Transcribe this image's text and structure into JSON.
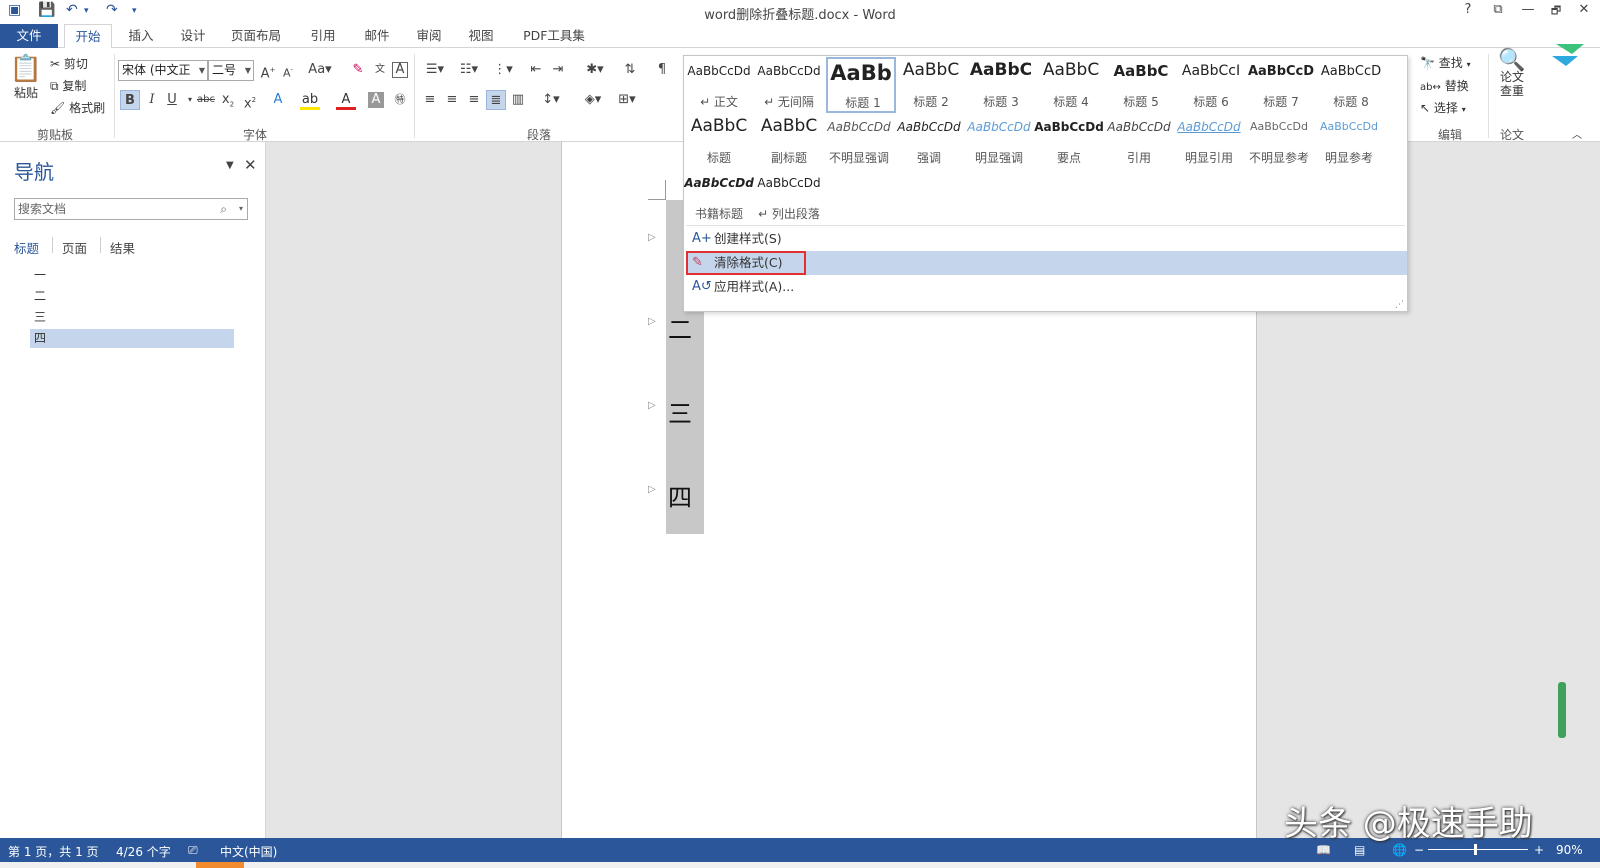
{
  "window": {
    "title": "word删除折叠标题.docx - Word",
    "help": "?",
    "restore_ribbon": "⧉",
    "minimize": "—",
    "maximize": "🗗",
    "close": "✕"
  },
  "tabs": [
    "文件",
    "开始",
    "插入",
    "设计",
    "页面布局",
    "引用",
    "邮件",
    "审阅",
    "视图",
    "PDF工具集"
  ],
  "ribbon": {
    "clipboard": {
      "paste": "粘贴",
      "cut": "剪切",
      "copy": "复制",
      "format_painter": "格式刷",
      "label": "剪贴板"
    },
    "font": {
      "font_name": "宋体 (中文正",
      "font_size": "二号",
      "label": "字体"
    },
    "paragraph": {
      "label": "段落"
    },
    "editing": {
      "find": "查找",
      "replace": "替换",
      "select": "选择",
      "label": "编辑"
    },
    "thesis": {
      "check_line1": "论文",
      "check_line2": "查重",
      "label": "论文"
    }
  },
  "navigation": {
    "title": "导航",
    "search_placeholder": "搜索文档",
    "tabs": [
      "标题",
      "页面",
      "结果"
    ],
    "headings": [
      "一",
      "二",
      "三",
      "四"
    ],
    "selected_heading_index": 3
  },
  "document": {
    "headings": [
      "二",
      "三",
      "四"
    ]
  },
  "style_gallery": {
    "styles": [
      {
        "sample": "AaBbCcDd",
        "name": "↵ 正文"
      },
      {
        "sample": "AaBbCcDd",
        "name": "↵ 无间隔"
      },
      {
        "sample": "AaBb",
        "name": "标题 1"
      },
      {
        "sample": "AaBbC",
        "name": "标题 2"
      },
      {
        "sample": "AaBbC",
        "name": "标题 3"
      },
      {
        "sample": "AaBbC",
        "name": "标题 4"
      },
      {
        "sample": "AaBbC",
        "name": "标题 5"
      },
      {
        "sample": "AaBbCcI",
        "name": "标题 6"
      },
      {
        "sample": "AaBbCcD",
        "name": "标题 7"
      },
      {
        "sample": "AaBbCcD",
        "name": "标题 8"
      },
      {
        "sample": "AaBbC",
        "name": "标题"
      },
      {
        "sample": "AaBbC",
        "name": "副标题"
      },
      {
        "sample": "AaBbCcDd",
        "name": "不明显强调"
      },
      {
        "sample": "AaBbCcDd",
        "name": "强调"
      },
      {
        "sample": "AaBbCcDd",
        "name": "明显强调"
      },
      {
        "sample": "AaBbCcDd",
        "name": "要点"
      },
      {
        "sample": "AaBbCcDd",
        "name": "引用"
      },
      {
        "sample": "AaBbCcDd",
        "name": "明显引用"
      },
      {
        "sample": "AaBbCcDd",
        "name": "不明显参考"
      },
      {
        "sample": "AaBbCcDd",
        "name": "明显参考"
      },
      {
        "sample": "AaBbCcDd",
        "name": "书籍标题"
      },
      {
        "sample": "AaBbCcDd",
        "name": "↵ 列出段落"
      }
    ],
    "create_style": "创建样式(S)",
    "clear_formatting": "清除格式(C)",
    "apply_styles": "应用样式(A)..."
  },
  "status": {
    "page": "第 1 页，共 1 页",
    "words": "4/26 个字",
    "language": "中文(中国)",
    "zoom": "90%"
  },
  "watermark": "头条 @极速手助",
  "colors": {
    "accent": "#2b579a",
    "selection": "#c5d6ec",
    "highlight_border": "#e03030"
  }
}
